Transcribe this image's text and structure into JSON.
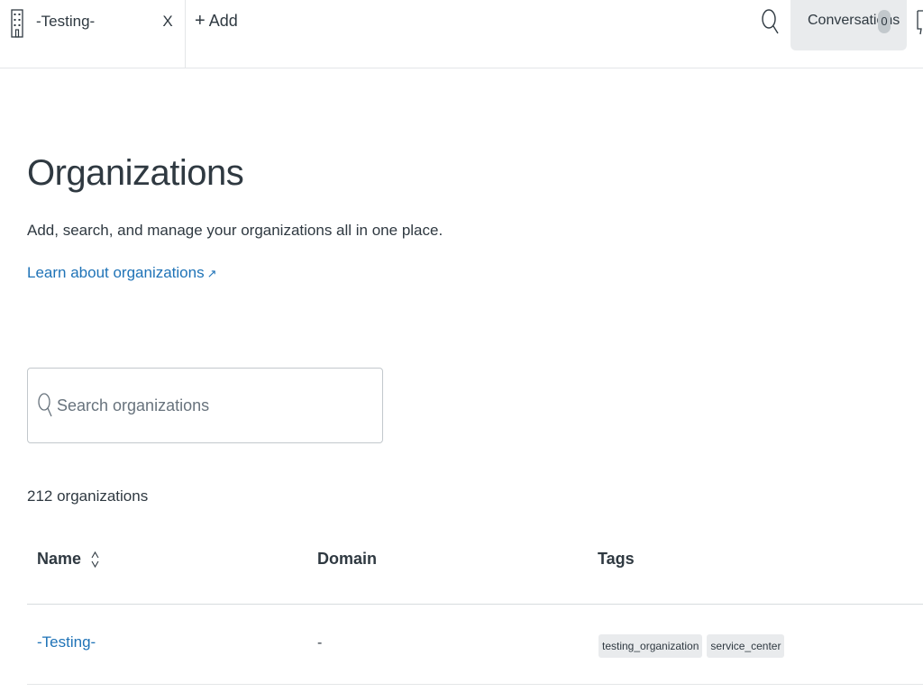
{
  "tabs": [
    {
      "label": "-Testing-",
      "close_label": "X",
      "icon": "building-icon"
    }
  ],
  "add_tab_label": "Add",
  "header": {
    "search_icon": "search-icon",
    "conversations_label": "Conversations",
    "conversations_count": "0",
    "chat_icon": "chat-icon"
  },
  "page": {
    "title": "Organizations",
    "subtitle": "Add, search, and manage your organizations all in one place.",
    "learn_link": "Learn about organizations",
    "learn_link_icon": "external-link-icon"
  },
  "search": {
    "placeholder": "Search organizations",
    "value": ""
  },
  "results_count": "212 organizations",
  "table": {
    "columns": [
      "Name",
      "Domain",
      "Tags"
    ],
    "rows": [
      {
        "name": "-Testing-",
        "domain": "-",
        "tags": [
          "testing_organization",
          "service_center"
        ]
      }
    ]
  },
  "colors": {
    "link": "#1f73b7",
    "text": "#2f3941",
    "tag_bg": "#e9ebed",
    "border": "#e4e6e8"
  }
}
